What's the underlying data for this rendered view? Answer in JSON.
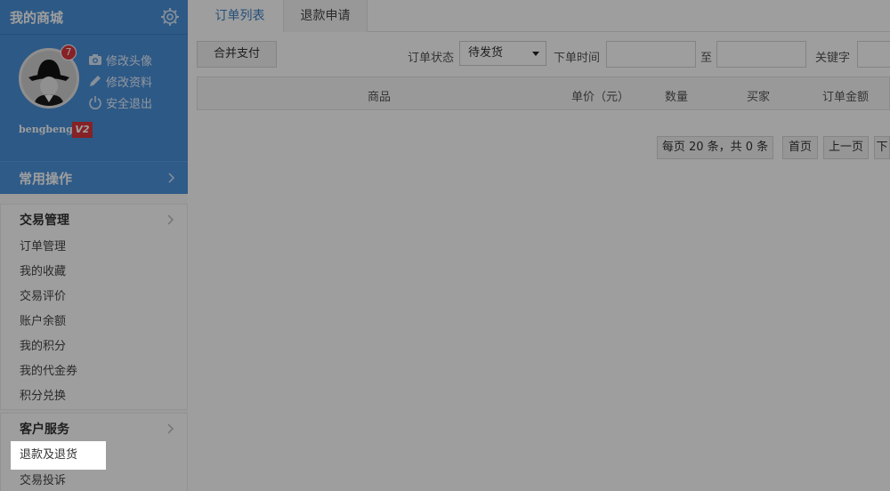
{
  "sidebar": {
    "title": "我的商城",
    "unread_count": "7",
    "links": {
      "change_avatar": "修改头像",
      "edit_profile": "修改资料",
      "logout": "安全退出"
    },
    "username": "bengbeng",
    "vip_level": "V2",
    "common_ops": "常用操作",
    "trade": {
      "heading": "交易管理",
      "items": [
        "订单管理",
        "我的收藏",
        "交易评价",
        "账户余额",
        "我的积分",
        "我的代金券",
        "积分兑换"
      ]
    },
    "service": {
      "heading": "客户服务",
      "items": [
        "退款及退货",
        "交易投诉"
      ],
      "active": "退款及退货"
    }
  },
  "main": {
    "tabs": [
      "订单列表",
      "退款申请"
    ],
    "merge_pay": "合并支付",
    "filters": {
      "status_label": "订单状态",
      "status_value": "待发货",
      "time_label": "下单时间",
      "to_label": "至",
      "keyword_label": "关键字"
    },
    "table_headers": [
      "商品",
      "单价（元）",
      "数量",
      "买家",
      "订单金额"
    ],
    "pager": {
      "summary": "每页 20 条，共 0 条",
      "first": "首页",
      "prev": "上一页",
      "next": "下"
    }
  },
  "colors": {
    "sidebar_blue": "#4a90d9",
    "tab_active": "#3b82c4",
    "badge_red": "#d9363e"
  }
}
